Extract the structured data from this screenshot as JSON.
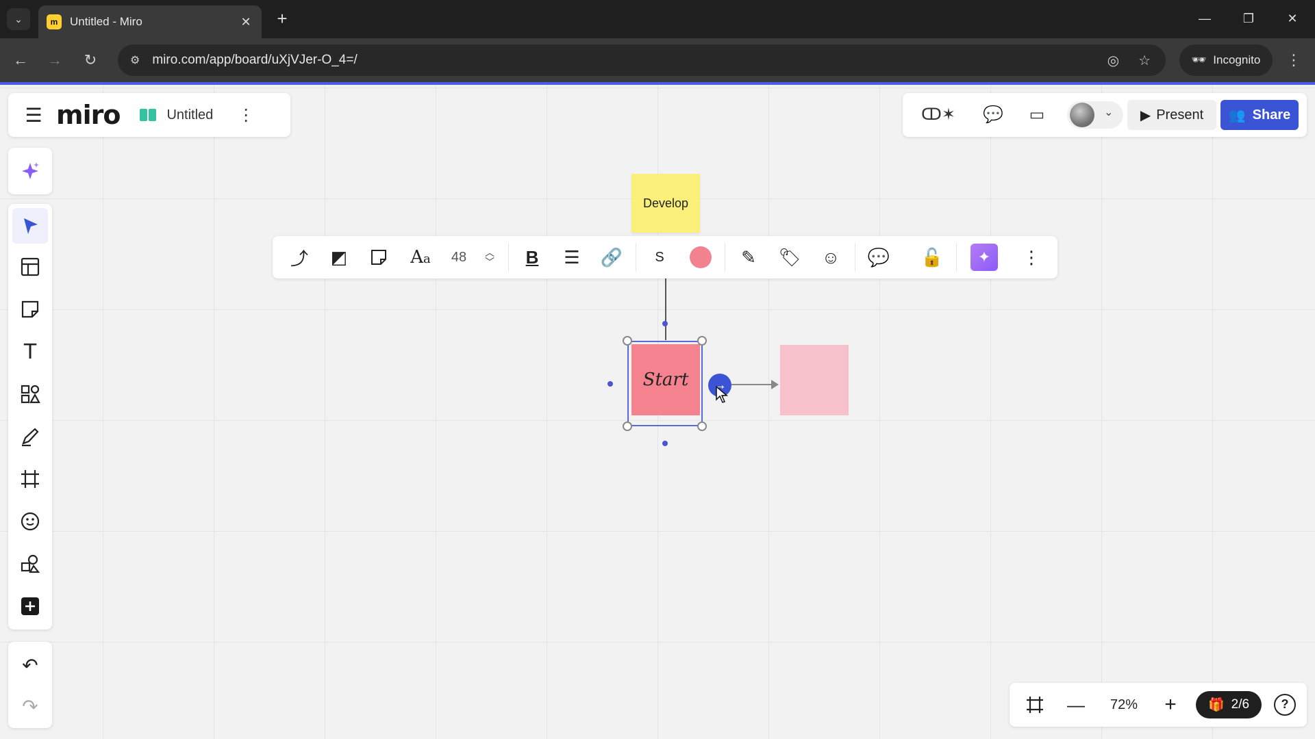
{
  "browser": {
    "tab_title": "Untitled - Miro",
    "favicon_label": "m",
    "url": "miro.com/app/board/uXjVJer-O_4=/",
    "incognito_label": "Incognito"
  },
  "header": {
    "logo": "miro",
    "board_name": "Untitled",
    "present_label": "Present",
    "share_label": "Share"
  },
  "context_toolbar": {
    "font_size": "48",
    "stroke_label": "S",
    "fill_color": "#f2828e"
  },
  "board": {
    "sticky_top_text": "Develop",
    "sticky_selected_text": "Start"
  },
  "zoom": {
    "level": "72%",
    "pages": "2/6"
  },
  "colors": {
    "accent": "#3b54d6",
    "sticky_yellow": "#fbf07a",
    "sticky_pink": "#f5838f",
    "sticky_pink_preview": "#f7c1cb"
  }
}
